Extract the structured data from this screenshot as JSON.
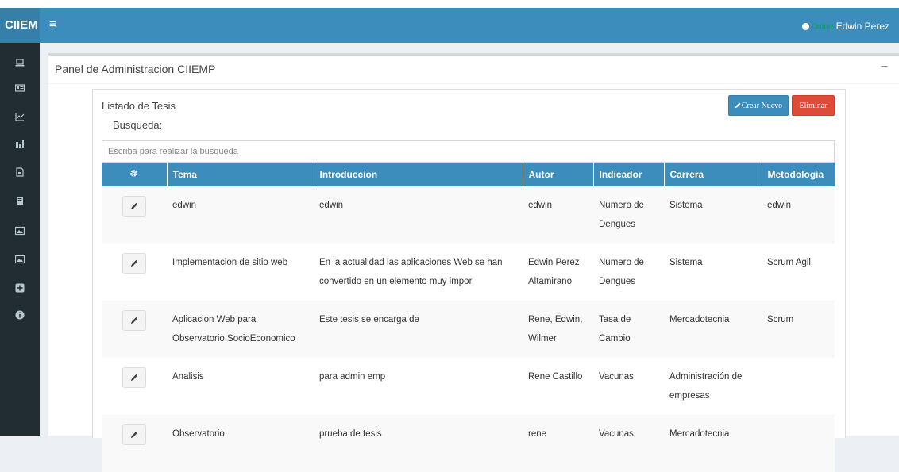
{
  "app": {
    "logo": "CIIEM",
    "menu_icon": "hamburger-icon"
  },
  "user": {
    "status": "Online",
    "name": "Edwin Perez"
  },
  "sidebar": {
    "icons": [
      "laptop-icon",
      "id-card-icon",
      "line-chart-icon",
      "bar-chart-icon",
      "file-pdf-icon",
      "book-icon",
      "image-icon",
      "image-icon",
      "plus-square-icon",
      "info-circle-icon"
    ]
  },
  "panel": {
    "title": "Panel de Administracion CIIEMP",
    "collapse": "−"
  },
  "list": {
    "title": "Listado de Tesis",
    "search_label": "Busqueda:",
    "search_placeholder": "Escriba para realizar la busqueda",
    "create_label": "Crear Nuevo",
    "delete_label": "Eliminar"
  },
  "table": {
    "columns": [
      "Tema",
      "Introduccion",
      "Autor",
      "Indicador",
      "Carrera",
      "Metodologia"
    ],
    "rows": [
      {
        "tema": "edwin",
        "introduccion": "edwin",
        "autor": "edwin",
        "indicador": "Numero de Dengues",
        "carrera": "Sistema",
        "metodologia": "edwin"
      },
      {
        "tema": "Implementacion de sitio web",
        "introduccion": "En la actualidad las aplicaciones Web se han convertido en un elemento muy impor",
        "autor": "Edwin Perez Altamirano",
        "indicador": "Numero de Dengues",
        "carrera": "Sistema",
        "metodologia": "Scrum Agil"
      },
      {
        "tema": "Aplicacion Web para Observatorio SocioEconomico",
        "introduccion": "Este tesis se encarga de",
        "autor": "Rene, Edwin, Wilmer",
        "indicador": "Tasa de Cambio",
        "carrera": "Mercadotecnia",
        "metodologia": "Scrum"
      },
      {
        "tema": "Analisis",
        "introduccion": "para admin emp",
        "autor": "Rene Castillo",
        "indicador": "Vacunas",
        "carrera": "Administración de empresas",
        "metodologia": ""
      },
      {
        "tema": "Observatorio",
        "introduccion": "prueba de tesis",
        "autor": "rene",
        "indicador": "Vacunas",
        "carrera": "Mercadotecnia",
        "metodologia": ""
      }
    ]
  }
}
